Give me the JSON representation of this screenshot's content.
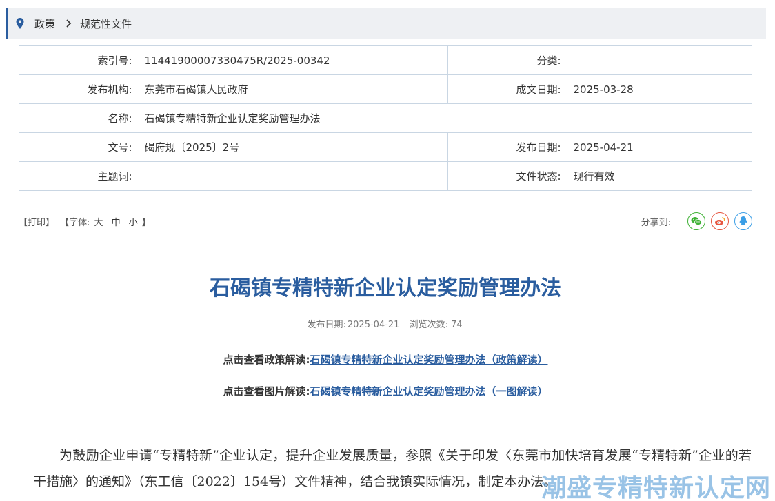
{
  "breadcrumb": {
    "items": [
      "政策",
      "规范性文件"
    ],
    "separator": "›"
  },
  "meta": {
    "index_label": "索引号:",
    "index_value": "11441900007330475R/2025-00342",
    "category_label": "分类:",
    "category_value": "",
    "publisher_label": "发布机构:",
    "publisher_value": "东莞市石碣镇人民政府",
    "written_date_label": "成文日期:",
    "written_date_value": "2025-03-28",
    "name_label": "名称:",
    "name_value": "石碣镇专精特新企业认定奖励管理办法",
    "docno_label": "文号:",
    "docno_value": "碣府规〔2025〕2号",
    "pub_date_label": "发布日期:",
    "pub_date_value": "2025-04-21",
    "keywords_label": "主题词:",
    "keywords_value": "",
    "status_label": "文件状态:",
    "status_value": "现行有效"
  },
  "toolbar": {
    "print": "【打印】",
    "font_prefix": "【字体:",
    "font_large": "大",
    "font_medium": "中",
    "font_small": "小",
    "font_suffix": "】",
    "share_label": "分享到:"
  },
  "article": {
    "title": "石碣镇专精特新企业认定奖励管理办法",
    "pub_date_label": "发布日期:",
    "pub_date": "2025-04-21",
    "views_label": "浏览次数:",
    "views": "74",
    "policy_interp_label": "点击查看政策解读:",
    "policy_interp_link": "石碣镇专精特新企业认定奖励管理办法（政策解读）",
    "image_interp_label": "点击查看图片解读:",
    "image_interp_link": "石碣镇专精特新企业认定奖励管理办法（一图解读）",
    "body": "为鼓励企业申请“专精特新”企业认定，提升企业发展质量，参照《关于印发〈东莞市加快培育发展“专精特新”企业的若干措施〉的通知》（东工信〔2022〕154号）文件精神，结合我镇实际情况，制定本办法。"
  },
  "watermark": "潮盛专精特新认定网",
  "colors": {
    "accent": "#2a5d9f",
    "wechat": "#3eb135",
    "weibo": "#e6553f",
    "qq": "#3a9ee6"
  }
}
